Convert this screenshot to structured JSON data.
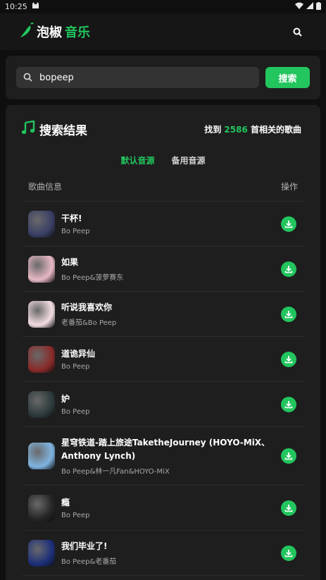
{
  "status_bar": {
    "time": "10:25"
  },
  "header": {
    "logo_part1": "泡椒",
    "logo_part2": "音乐"
  },
  "search": {
    "value": "bopeep",
    "button_label": "搜索"
  },
  "results": {
    "title": "搜索结果",
    "count_prefix": "找到",
    "count": "2586",
    "count_suffix": "首相关的歌曲",
    "tabs": [
      {
        "label": "默认音源"
      },
      {
        "label": "备用音源"
      }
    ],
    "columns": {
      "info": "歌曲信息",
      "action": "操作"
    },
    "songs": [
      {
        "title": "干杯!",
        "artist": "Bo Peep",
        "cover_color": "#3a3f66"
      },
      {
        "title": "如果",
        "artist": "Bo Peep&菠萝赛东",
        "cover_color": "#e7b8c4"
      },
      {
        "title": "听说我喜欢你",
        "artist": "老番茄&Bo Peep",
        "cover_color": "#f3dde2"
      },
      {
        "title": "道诡异仙",
        "artist": "Bo Peep",
        "cover_color": "#8a2a2a"
      },
      {
        "title": "妒",
        "artist": "Bo Peep",
        "cover_color": "#2d3a3c"
      },
      {
        "title": "星穹铁道-踏上旅途TaketheJourney (HOYO-MiX、Anthony Lynch)",
        "artist": "Bo Peep&林一凡Fan&HOYO-MiX",
        "cover_color": "#7fb4e0"
      },
      {
        "title": "瘾",
        "artist": "Bo Peep",
        "cover_color": "#262626"
      },
      {
        "title": "我们毕业了!",
        "artist": "Bo Peep&老番茄",
        "cover_color": "#1c2f7a"
      }
    ]
  },
  "colors": {
    "accent": "#22c55e",
    "background": "#0f0f0f",
    "card": "#1e1e1e"
  }
}
